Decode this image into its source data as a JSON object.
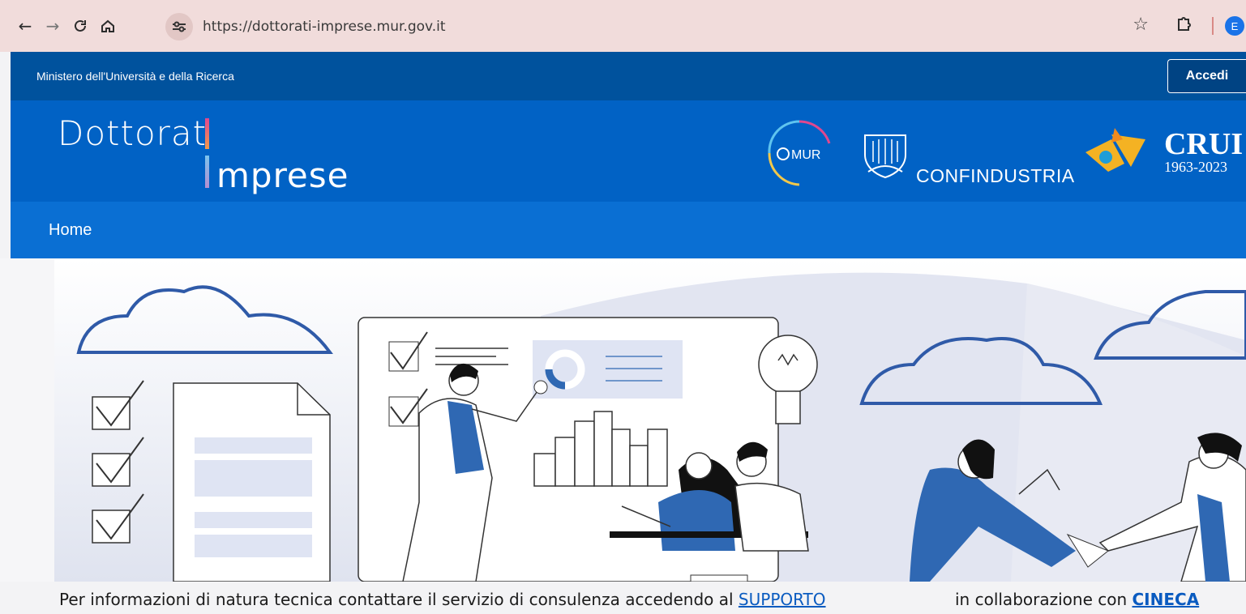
{
  "browser": {
    "url": "https://dottorati-imprese.mur.gov.it",
    "profile_initial": "E"
  },
  "topbar": {
    "ministry": "Ministero dell'Università e della Ricerca",
    "login_label": "Accedi"
  },
  "brand": {
    "logo_word1": "Dottorat",
    "logo_word2": "mprese",
    "partner_mur": "MUR",
    "partner_confindustria": "CONFINDUSTRIA",
    "partner_crui": "CRUI",
    "partner_crui_years": "1963-2023"
  },
  "nav": {
    "items": [
      {
        "label": "Home"
      }
    ]
  },
  "footer": {
    "info_text": "Per informazioni di natura tecnica contattare il servizio di consulenza accedendo al ",
    "support_link": "SUPPORTO",
    "collab_text": "in collaborazione con ",
    "cineca_link": "CINECA"
  },
  "colors": {
    "topbar": "#00529d",
    "brand": "#0162c5",
    "nav": "#0a6fd3",
    "accent_blue": "#2f68b3"
  }
}
